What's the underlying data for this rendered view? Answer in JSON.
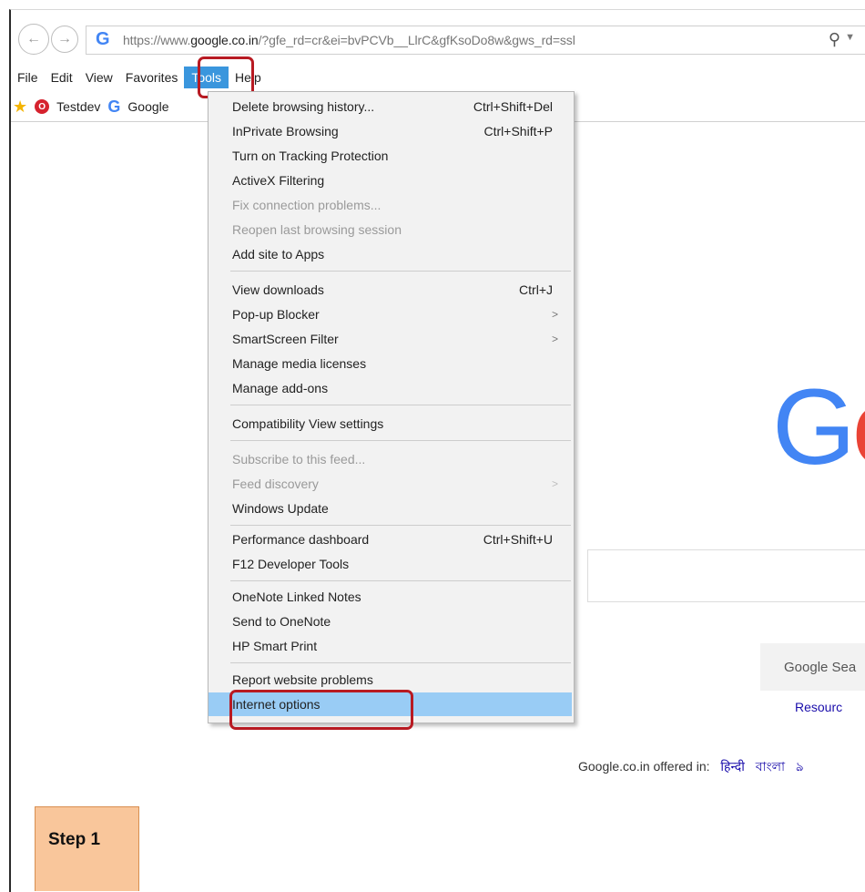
{
  "browser": {
    "url_prefix": "https://www.",
    "url_domain": "google.co.in",
    "url_suffix": "/?gfe_rd=cr&ei=bvPCVb__LlrC&gfKsoDo8w&gws_rd=ssl",
    "favicon": "G",
    "search_icon": "search-icon"
  },
  "menubar": {
    "items": [
      "File",
      "Edit",
      "View",
      "Favorites",
      "Tools",
      "Help"
    ]
  },
  "favorites": {
    "items": [
      "Testdev",
      "Google"
    ]
  },
  "tools_menu": {
    "items": [
      {
        "label": "Delete browsing history...",
        "shortcut": "Ctrl+Shift+Del"
      },
      {
        "label": "InPrivate Browsing",
        "shortcut": "Ctrl+Shift+P"
      },
      {
        "label": "Turn on Tracking Protection"
      },
      {
        "label": "ActiveX Filtering"
      },
      {
        "label": "Fix connection problems...",
        "disabled": true
      },
      {
        "label": "Reopen last browsing session",
        "disabled": true
      },
      {
        "label": "Add site to Apps"
      },
      {
        "label": "View downloads",
        "shortcut": "Ctrl+J"
      },
      {
        "label": "Pop-up Blocker",
        "submenu": ">"
      },
      {
        "label": "SmartScreen Filter",
        "submenu": ">"
      },
      {
        "label": "Manage media licenses"
      },
      {
        "label": "Manage add-ons"
      },
      {
        "label": "Compatibility View settings"
      },
      {
        "label": "Subscribe to this feed...",
        "disabled": true
      },
      {
        "label": "Feed discovery",
        "disabled": true,
        "submenu": ">"
      },
      {
        "label": "Windows Update"
      },
      {
        "label": "Performance dashboard",
        "shortcut": "Ctrl+Shift+U"
      },
      {
        "label": "F12 Developer Tools"
      },
      {
        "label": "OneNote Linked Notes"
      },
      {
        "label": "Send to OneNote"
      },
      {
        "label": "HP Smart Print"
      },
      {
        "label": "Report website problems"
      },
      {
        "label": "Internet options",
        "selected": true
      }
    ]
  },
  "google": {
    "logo_partial": "Go",
    "search_button": "Google Sea",
    "resources_link": "Resourc",
    "offered_in": "Google.co.in offered in:",
    "languages": [
      "हिन्दी",
      "বাংলা",
      "ঌ"
    ]
  },
  "step_label": "Step 1",
  "colors": {
    "highlight_red": "#b81a22",
    "menu_selected": "#99ccf5",
    "tools_active": "#3a96dd",
    "step_fill": "#f9c69b"
  }
}
